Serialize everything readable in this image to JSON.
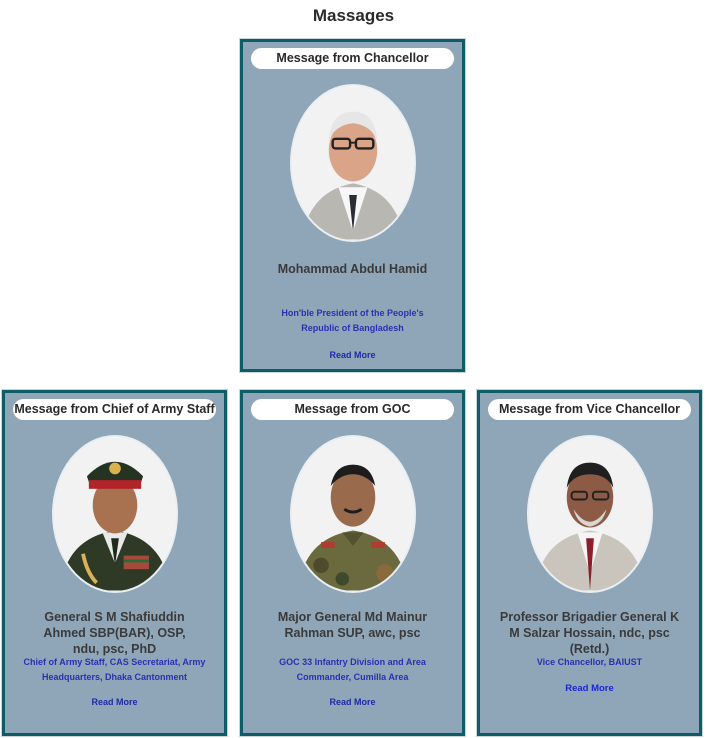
{
  "section": {
    "title": "Massages"
  },
  "cards": [
    {
      "header": "Message from Chancellor",
      "name": "Mohammad Abdul Hamid",
      "role": "Hon'ble President of the People's Republic of Bangladesh",
      "link": "Read More"
    },
    {
      "header": "Message from Chief of Army Staff",
      "name": "General S M Shafiuddin Ahmed SBP(BAR), OSP, ndu, psc, PhD",
      "role": "Chief of Army Staff, CAS Secretariat, Army Headquarters, Dhaka Cantonment",
      "link": "Read More"
    },
    {
      "header": "Message from GOC",
      "name": "Major General Md Mainur Rahman SUP, awc, psc",
      "role": "GOC 33 Infantry Division and Area Commander, Cumilla Area",
      "link": "Read More"
    },
    {
      "header": "Message from Vice Chancellor",
      "name": "Professor Brigadier General K M Salzar Hossain, ndc, psc (Retd.)",
      "role": "Vice Chancellor, BAIUST",
      "link": "Read More"
    }
  ]
}
